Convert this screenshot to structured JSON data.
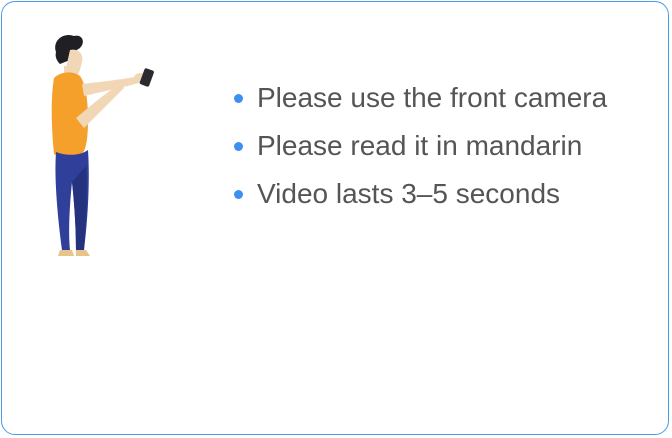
{
  "tips": [
    {
      "text": "Please use the front camera"
    },
    {
      "text": "Please read it in mandarin"
    },
    {
      "text": "Video lasts 3–5 seconds"
    }
  ],
  "colors": {
    "border": "#4a9ce8",
    "bullet": "#3d8ff0",
    "text": "#555555",
    "shirt": "#f4a02a",
    "pants": "#2f3f9a"
  },
  "icons": {
    "illustration": "person-recording-selfie-video-illustration"
  }
}
